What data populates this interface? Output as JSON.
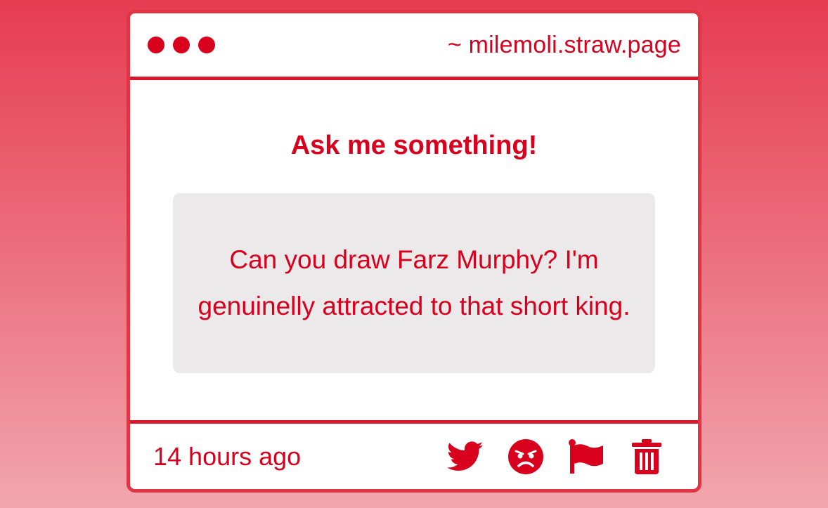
{
  "titlebar": {
    "url": "~ milemoli.straw.page"
  },
  "main": {
    "heading": "Ask me something!",
    "question": "Can you draw Farz Murphy? I'm genuinelly attracted to that short king."
  },
  "footer": {
    "timestamp": "14 hours ago",
    "actions": [
      {
        "icon": "twitter-bird-icon"
      },
      {
        "icon": "angry-face-icon"
      },
      {
        "icon": "flag-icon"
      },
      {
        "icon": "trash-icon"
      }
    ]
  },
  "colors": {
    "accent": "#d9001e",
    "frame": "#e23442",
    "question_bg": "#ebe9ea"
  }
}
